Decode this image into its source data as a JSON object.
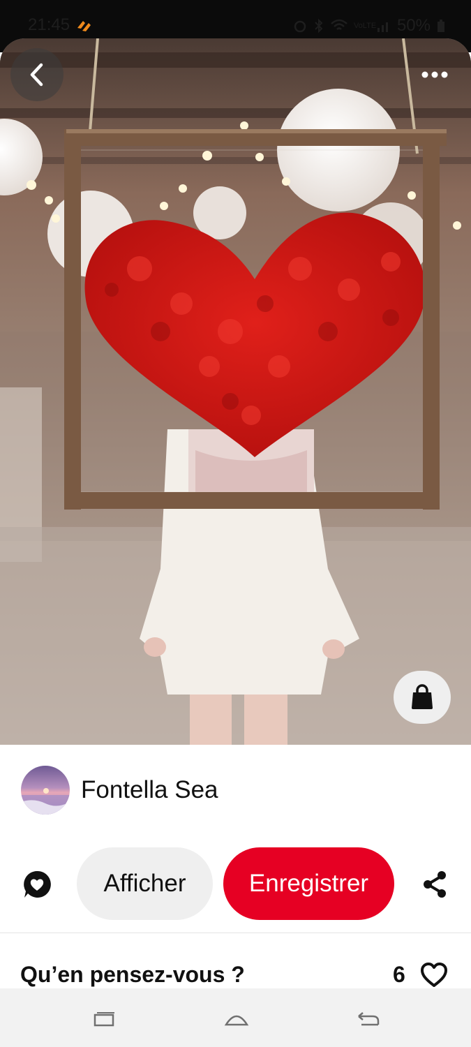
{
  "status_bar": {
    "time": "21:45",
    "battery": "50%",
    "network": "VoLTE"
  },
  "pin": {
    "back_icon": "chevron-left-icon",
    "more_icon": "more-horizontal-icon",
    "shop_icon": "shopping-bag-icon"
  },
  "creator": {
    "name": "Fontella Sea"
  },
  "actions": {
    "comment_icon": "comment-heart-icon",
    "view_label": "Afficher",
    "save_label": "Enregistrer",
    "share_icon": "share-icon"
  },
  "comments": {
    "title": "Qu’en pensez-vous ?",
    "like_count": "6"
  },
  "colors": {
    "save_button": "#e60023",
    "secondary_button": "#efefef",
    "text": "#111111"
  },
  "nav_bar": {
    "items": [
      "recent-apps-icon",
      "home-icon",
      "back-icon"
    ]
  }
}
